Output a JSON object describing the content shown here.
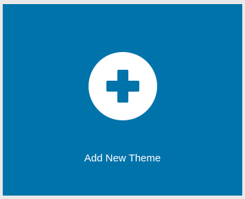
{
  "add_theme": {
    "label": "Add New Theme",
    "icon": "plus-icon",
    "background_color": "#0073aa",
    "icon_circle_color": "#ffffff"
  }
}
